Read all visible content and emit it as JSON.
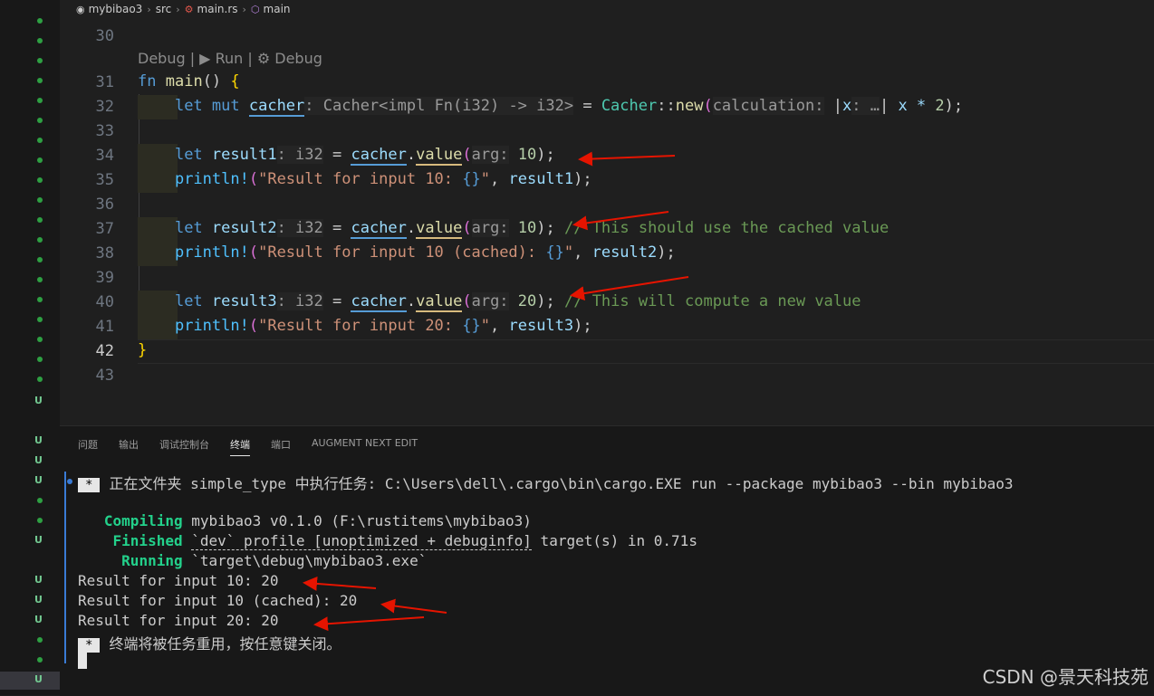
{
  "breadcrumb": {
    "project": "mybibao3",
    "folder": "src",
    "file": "main.rs",
    "symbol": "main"
  },
  "codelens": "Debug | ▶ Run | ⚙ Debug",
  "line_numbers": [
    "30",
    "31",
    "32",
    "33",
    "34",
    "35",
    "36",
    "37",
    "38",
    "39",
    "40",
    "41",
    "42",
    "43"
  ],
  "code": {
    "l31_kw": "fn",
    "l31_name": "main",
    "l31_rest": "() ",
    "l31_brace": "{",
    "l32_let": "let mut",
    "l32_var": "cacher",
    "l32_hint": ": Cacher<impl Fn(i32) -> i32>",
    "l32_eq": " = ",
    "l32_type": "Cacher",
    "l32_sep": "::",
    "l32_new": "new",
    "l32_paren": "(",
    "l32_arghint": "calculation:",
    "l32_closure_open": " |",
    "l32_x": "x",
    "l32_xhint": ": …",
    "l32_closure_close": "|",
    "l32_body": " x * ",
    "l32_num": "2",
    "l32_end": ");",
    "l34_let": "let",
    "l34_var": "result1",
    "l34_hint": ": i32",
    "l34_eq": " = ",
    "l34_obj": "cacher",
    "l34_dot": ".",
    "l34_method": "value",
    "l34_paren": "(",
    "l34_arghint": "arg:",
    "l34_num": " 10",
    "l34_end": ");",
    "l35_mac": "println!",
    "l35_open": "(",
    "l35_str": "\"Result for input 10: ",
    "l35_fmt": "{}",
    "l35_strend": "\"",
    "l35_comma": ", ",
    "l35_var": "result1",
    "l35_end": ");",
    "l37_let": "let",
    "l37_var": "result2",
    "l37_hint": ": i32",
    "l37_eq": " = ",
    "l37_obj": "cacher",
    "l37_dot": ".",
    "l37_method": "value",
    "l37_paren": "(",
    "l37_arghint": "arg:",
    "l37_num": " 10",
    "l37_end": ");",
    "l37_comment": " // This should use the cached value",
    "l38_mac": "println!",
    "l38_open": "(",
    "l38_str": "\"Result for input 10 (cached): ",
    "l38_fmt": "{}",
    "l38_strend": "\"",
    "l38_comma": ", ",
    "l38_var": "result2",
    "l38_end": ");",
    "l40_let": "let",
    "l40_var": "result3",
    "l40_hint": ": i32",
    "l40_eq": " = ",
    "l40_obj": "cacher",
    "l40_dot": ".",
    "l40_method": "value",
    "l40_paren": "(",
    "l40_arghint": "arg:",
    "l40_num": " 20",
    "l40_end": ");",
    "l40_comment": " // This will compute a new value",
    "l41_mac": "println!",
    "l41_open": "(",
    "l41_str": "\"Result for input 20: ",
    "l41_fmt": "{}",
    "l41_strend": "\"",
    "l41_comma": ", ",
    "l41_var": "result3",
    "l41_end": ");",
    "l42_brace": "}"
  },
  "panel_tabs": [
    "问题",
    "输出",
    "调试控制台",
    "终端",
    "端口",
    "AUGMENT NEXT EDIT"
  ],
  "active_tab": "终端",
  "terminal": {
    "task_star": "*",
    "task_line": "正在文件夹 simple_type 中执行任务: C:\\Users\\dell\\.cargo\\bin\\cargo.EXE run --package mybibao3 --bin mybibao3",
    "compiling_label": "Compiling",
    "compiling_text": " mybibao3 v0.1.0 (F:\\rustitems\\mybibao3)",
    "finished_label": "Finished",
    "finished_text_pre": " ",
    "finished_dashed": "`dev` profile [unoptimized + debuginfo]",
    "finished_text_post": " target(s) in 0.71s",
    "running_label": "Running",
    "running_text": " `target\\debug\\mybibao3.exe`",
    "output": [
      "Result for input 10: 20",
      "Result for input 10 (cached): 20",
      "Result for input 20: 20"
    ],
    "end_star": "*",
    "end_line": "终端将被任务重用，按任意键关闭。"
  },
  "gutter_status": "U",
  "watermark": "CSDN @景天科技苑",
  "colors": {
    "accent_blue": "#3a7bd5",
    "git_added": "#2ea043",
    "annotation_red": "#e51400"
  }
}
